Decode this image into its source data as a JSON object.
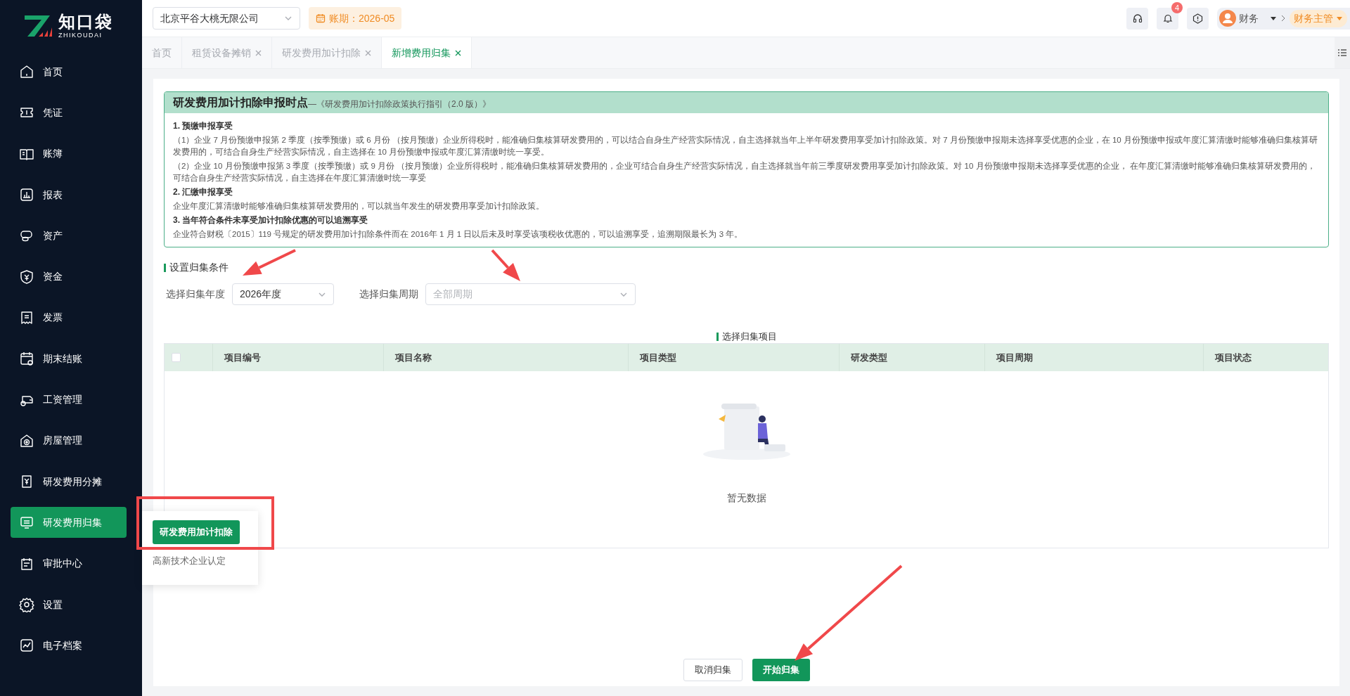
{
  "logo": {
    "name": "知口袋",
    "subtitle": "ZHIKOUDAI"
  },
  "company_select": {
    "value": "北京平谷大桃无限公司"
  },
  "period_badge": {
    "label": "账期：2026-05"
  },
  "notifications": {
    "count": "4"
  },
  "user": {
    "name": "财务",
    "role": "财务主管"
  },
  "sidebar": {
    "items": [
      {
        "label": "首页",
        "selected": false
      },
      {
        "label": "凭证",
        "selected": false
      },
      {
        "label": "账簿",
        "selected": false
      },
      {
        "label": "报表",
        "selected": false
      },
      {
        "label": "资产",
        "selected": false
      },
      {
        "label": "资金",
        "selected": false
      },
      {
        "label": "发票",
        "selected": false
      },
      {
        "label": "期末结账",
        "selected": false
      },
      {
        "label": "工资管理",
        "selected": false
      },
      {
        "label": "房屋管理",
        "selected": false
      },
      {
        "label": "研发费用分摊",
        "selected": false
      },
      {
        "label": "研发费用归集",
        "selected": true
      },
      {
        "label": "审批中心",
        "selected": false
      },
      {
        "label": "设置",
        "selected": false
      },
      {
        "label": "电子档案",
        "selected": false
      }
    ]
  },
  "submenu": {
    "items": [
      {
        "label": "研发费用加计扣除",
        "selected": true
      },
      {
        "label": "高新技术企业认定",
        "selected": false
      }
    ]
  },
  "tabs": [
    {
      "label": "首页",
      "closable": false,
      "selected": false
    },
    {
      "label": "租赁设备摊销",
      "closable": true,
      "selected": false
    },
    {
      "label": "研发费用加计扣除",
      "closable": true,
      "selected": false
    },
    {
      "label": "新增费用归集",
      "closable": true,
      "selected": true
    }
  ],
  "notice": {
    "title": "研发费用加计扣除申报时点",
    "source": "—《研发费用加计扣除政策执行指引（2.0 版）》",
    "sections": [
      {
        "heading": "1. 预缴申报享受",
        "paragraphs": [
          "（1）企业 7 月份预缴申报第 2 季度（按季预缴）或 6 月份 （按月预缴）企业所得税时，能准确归集核算研发费用的，可以结合自身生产经营实际情况，自主选择就当年上半年研发费用享受加计扣除政策。对 7 月份预缴申报期未选择享受优惠的企业，在 10 月份预缴申报或年度汇算清缴时能够准确归集核算研发费用的，可结合自身生产经营实际情况，自主选择在 10 月份预缴申报或年度汇算清缴时统一享受。",
          "（2）企业 10 月份预缴申报第 3 季度（按季预缴）或 9 月份 （按月预缴）企业所得税时，能准确归集核算研发费用的，企业可结合自身生产经营实际情况，自主选择就当年前三季度研发费用享受加计扣除政策。对 10 月份预缴申报期未选择享受优惠的企业， 在年度汇算清缴时能够准确归集核算研发费用的，可结合自身生产经营实际情况，自主选择在年度汇算清缴时统一享受"
        ]
      },
      {
        "heading": "2. 汇缴申报享受",
        "paragraphs": [
          "企业年度汇算清缴时能够准确归集核算研发费用的，可以就当年发生的研发费用享受加计扣除政策。"
        ]
      },
      {
        "heading": "3. 当年符合条件未享受加计扣除优惠的可以追溯享受",
        "paragraphs": [
          "企业符合财税〔2015〕119 号规定的研发费用加计扣除条件而在 2016年 1 月 1 日以后未及时享受该项税收优惠的，可以追溯享受，追溯期限最长为 3 年。"
        ]
      }
    ]
  },
  "conditions": {
    "title": "设置归集条件",
    "year_label": "选择归集年度",
    "year_value": "2026年度",
    "period_label": "选择归集周期",
    "period_placeholder": "全部周期"
  },
  "table": {
    "title": "选择归集项目",
    "select_all_checked": false,
    "columns": [
      "项目编号",
      "项目名称",
      "项目类型",
      "研发类型",
      "项目周期",
      "项目状态"
    ],
    "empty_text": "暂无数据"
  },
  "buttons": [
    {
      "label": "取消归集",
      "kind": "secondary"
    },
    {
      "label": "开始归集",
      "kind": "primary"
    }
  ],
  "annotations": [
    {
      "kind": "arrow"
    },
    {
      "kind": "arrow"
    },
    {
      "kind": "arrow"
    },
    {
      "kind": "box"
    }
  ]
}
